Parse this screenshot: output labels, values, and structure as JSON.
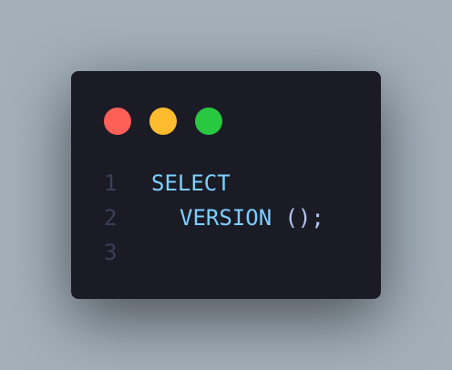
{
  "window": {
    "controls": [
      {
        "name": "close",
        "color": "#fe5f57"
      },
      {
        "name": "minimize",
        "color": "#febc2e"
      },
      {
        "name": "maximize",
        "color": "#28c840"
      }
    ],
    "background": "#1b1b26"
  },
  "code": {
    "lines": [
      {
        "number": "1",
        "tokens": [
          "SELECT"
        ]
      },
      {
        "number": "2",
        "tokens": [
          "VERSION",
          " ();"
        ]
      },
      {
        "number": "3",
        "tokens": []
      }
    ]
  },
  "colors": {
    "page_background": "#a3b0ba",
    "keyword": "#7dcfff",
    "punctuation": "#b4c7f0",
    "line_number": "#3b4055"
  }
}
